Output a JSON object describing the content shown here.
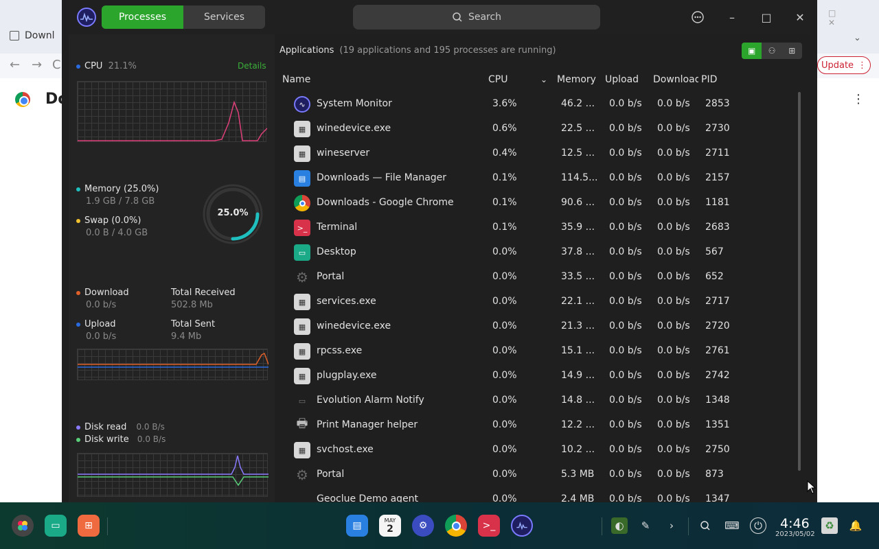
{
  "background_browser": {
    "tab_label": "Downl",
    "update_label": "Update",
    "page_title": "Do"
  },
  "window": {
    "tabs": [
      "Processes",
      "Services"
    ],
    "search_placeholder": "Search"
  },
  "left_panel": {
    "cpu_label": "CPU",
    "cpu_value": "21.1%",
    "details_link": "Details",
    "memory_label": "Memory (25.0%)",
    "memory_sub": "1.9 GB / 7.8 GB",
    "swap_label": "Swap (0.0%)",
    "swap_sub": "0.0 B / 4.0 GB",
    "memory_gauge": "25.0%",
    "memory_fraction": 0.25,
    "download_label": "Download",
    "download_value": "0.0 b/s",
    "total_received_label": "Total Received",
    "total_received_value": "502.8 Mb",
    "upload_label": "Upload",
    "upload_value": "0.0 b/s",
    "total_sent_label": "Total Sent",
    "total_sent_value": "9.4 Mb",
    "disk_read_label": "Disk read",
    "disk_read_value": "0.0 B/s",
    "disk_write_label": "Disk write",
    "disk_write_value": "0.0 B/s"
  },
  "process_list": {
    "heading": "Applications",
    "summary": "(19 applications and 195 processes are running)",
    "columns": {
      "name": "Name",
      "cpu": "CPU",
      "memory": "Memory",
      "upload": "Upload",
      "download": "Download",
      "pid": "PID"
    },
    "rows": [
      {
        "icon": "system-monitor-icon",
        "name": "System Monitor",
        "cpu": "3.6%",
        "memory": "46.2 ...",
        "upload": "0.0 b/s",
        "download": "0.0 b/s",
        "pid": "2853"
      },
      {
        "icon": "wine-icon",
        "name": "winedevice.exe",
        "cpu": "0.6%",
        "memory": "22.5 ...",
        "upload": "0.0 b/s",
        "download": "0.0 b/s",
        "pid": "2730"
      },
      {
        "icon": "wine-icon",
        "name": "wineserver",
        "cpu": "0.4%",
        "memory": "12.5 ...",
        "upload": "0.0 b/s",
        "download": "0.0 b/s",
        "pid": "2711"
      },
      {
        "icon": "file-manager-icon",
        "name": "Downloads — File Manager",
        "cpu": "0.1%",
        "memory": "114.5...",
        "upload": "0.0 b/s",
        "download": "0.0 b/s",
        "pid": "2157"
      },
      {
        "icon": "chrome-icon",
        "name": "Downloads - Google Chrome",
        "cpu": "0.1%",
        "memory": "90.6 ...",
        "upload": "0.0 b/s",
        "download": "0.0 b/s",
        "pid": "1181"
      },
      {
        "icon": "terminal-icon",
        "name": "Terminal",
        "cpu": "0.1%",
        "memory": "35.9 ...",
        "upload": "0.0 b/s",
        "download": "0.0 b/s",
        "pid": "2683"
      },
      {
        "icon": "desktop-icon",
        "name": "Desktop",
        "cpu": "0.0%",
        "memory": "37.8 ...",
        "upload": "0.0 b/s",
        "download": "0.0 b/s",
        "pid": "567"
      },
      {
        "icon": "gear-icon",
        "name": "Portal",
        "cpu": "0.0%",
        "memory": "33.5 ...",
        "upload": "0.0 b/s",
        "download": "0.0 b/s",
        "pid": "652"
      },
      {
        "icon": "wine-icon",
        "name": "services.exe",
        "cpu": "0.0%",
        "memory": "22.1 ...",
        "upload": "0.0 b/s",
        "download": "0.0 b/s",
        "pid": "2717"
      },
      {
        "icon": "wine-icon",
        "name": "winedevice.exe",
        "cpu": "0.0%",
        "memory": "21.3 ...",
        "upload": "0.0 b/s",
        "download": "0.0 b/s",
        "pid": "2720"
      },
      {
        "icon": "wine-icon",
        "name": "rpcss.exe",
        "cpu": "0.0%",
        "memory": "15.1 ...",
        "upload": "0.0 b/s",
        "download": "0.0 b/s",
        "pid": "2761"
      },
      {
        "icon": "wine-icon",
        "name": "plugplay.exe",
        "cpu": "0.0%",
        "memory": "14.9 ...",
        "upload": "0.0 b/s",
        "download": "0.0 b/s",
        "pid": "2742"
      },
      {
        "icon": "alarm-icon",
        "name": "Evolution Alarm Notify",
        "cpu": "0.0%",
        "memory": "14.8 ...",
        "upload": "0.0 b/s",
        "download": "0.0 b/s",
        "pid": "1348"
      },
      {
        "icon": "printer-icon",
        "name": "Print Manager helper",
        "cpu": "0.0%",
        "memory": "12.2 ...",
        "upload": "0.0 b/s",
        "download": "0.0 b/s",
        "pid": "1351"
      },
      {
        "icon": "wine-icon",
        "name": "svchost.exe",
        "cpu": "0.0%",
        "memory": "10.2 ...",
        "upload": "0.0 b/s",
        "download": "0.0 b/s",
        "pid": "2750"
      },
      {
        "icon": "gear-icon",
        "name": "Portal",
        "cpu": "0.0%",
        "memory": "5.3 MB",
        "upload": "0.0 b/s",
        "download": "0.0 b/s",
        "pid": "873"
      },
      {
        "icon": "blank-icon",
        "name": "Geoclue Demo agent",
        "cpu": "0.0%",
        "memory": "2.4 MB",
        "upload": "0.0 b/s",
        "download": "0.0 b/s",
        "pid": "1347"
      }
    ]
  },
  "taskbar": {
    "time": "4:46",
    "date": "2023/05/02",
    "calendar_day": "2",
    "calendar_month": "MAY"
  },
  "colors": {
    "accent_green": "#2ca52c",
    "cpu_line": "#e0407a",
    "memory_teal": "#1fbfbf",
    "swap_yellow": "#f2c230",
    "download_orange": "#e0602a",
    "upload_blue": "#2a6ae0",
    "disk_read_purple": "#8a7aff",
    "disk_write_green": "#5ad07a"
  }
}
